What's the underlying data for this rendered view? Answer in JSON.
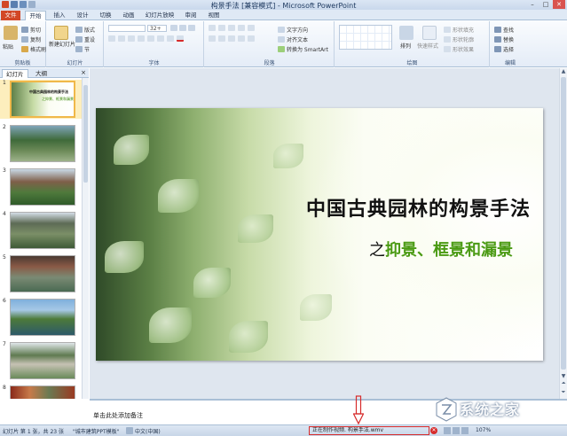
{
  "app": {
    "title": "构景手法 [兼容模式] - Microsoft PowerPoint"
  },
  "window_controls": [
    "–",
    "□",
    "✕"
  ],
  "ribbon_tabs": [
    "文件",
    "开始",
    "插入",
    "设计",
    "切换",
    "动画",
    "幻灯片放映",
    "审阅",
    "视图"
  ],
  "ribbon": {
    "clipboard": {
      "paste": "粘贴",
      "cut": "剪切",
      "copy": "复制",
      "format_painter": "格式刷",
      "label": "剪贴板"
    },
    "slides": {
      "new_slide": "新建幻灯片",
      "layout": "版式",
      "reset": "重设",
      "section": "节",
      "label": "幻灯片"
    },
    "font": {
      "size": "32+",
      "label": "字体"
    },
    "paragraph": {
      "text_direction": "文字方向",
      "align_text": "对齐文本",
      "smartart": "转换为 SmartArt",
      "label": "段落"
    },
    "drawing": {
      "arrange": "排列",
      "quick_styles": "快速样式",
      "shape_fill": "形状填充",
      "shape_outline": "形状轮廓",
      "shape_effects": "形状效果",
      "label": "绘图"
    },
    "editing": {
      "find": "查找",
      "replace": "替换",
      "select": "选择",
      "label": "编辑"
    }
  },
  "panel": {
    "tabs": [
      "幻灯片",
      "大纲"
    ],
    "close": "×"
  },
  "thumbnails": [
    {
      "num": "1",
      "title": "中国古典园林的构景手法",
      "sub": "之抑景、框景和漏景"
    },
    {
      "num": "2"
    },
    {
      "num": "3"
    },
    {
      "num": "4"
    },
    {
      "num": "5"
    },
    {
      "num": "6"
    },
    {
      "num": "7"
    },
    {
      "num": "8"
    }
  ],
  "slide": {
    "title": "中国古典园林的构景手法",
    "subtitle_prefix": "之",
    "subtitle_main": "抑景、框景和漏景"
  },
  "notes": {
    "placeholder": "单击此处添加备注"
  },
  "status": {
    "slide_info": "幻灯片 第 1 张，共 23 张",
    "theme": "\"城市建筑PPT模板\"",
    "language": "中文(中国)",
    "progress": "正在制作视频. 构景手法.wmv",
    "zoom": "107%"
  },
  "watermark": {
    "text": "系统之家"
  },
  "colors": {
    "file_tab": "#d24726",
    "subtitle_green": "#4a9a13",
    "highlight_red": "#d62b2b"
  }
}
